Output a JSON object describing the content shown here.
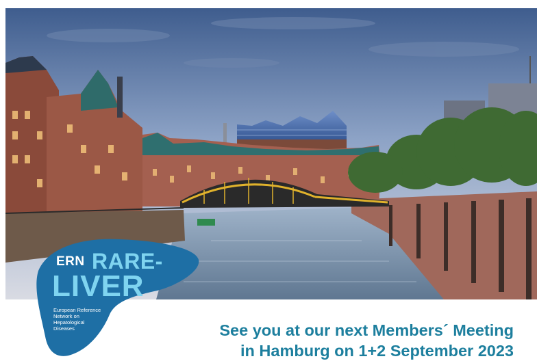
{
  "logo": {
    "ern": "ERN",
    "rare": "RARE-",
    "liver": "LIVER",
    "subtitle": [
      "European Reference",
      "Network on",
      "Hepatological",
      "Diseases"
    ]
  },
  "headline": {
    "line1": "See you at our next Members´ Meeting",
    "line2": "in Hamburg on 1+2 September 2023"
  },
  "colors": {
    "brand_dark_blue": "#1e6fa5",
    "brand_light_blue": "#7fd4f0",
    "headline_teal": "#1d7f9e"
  }
}
